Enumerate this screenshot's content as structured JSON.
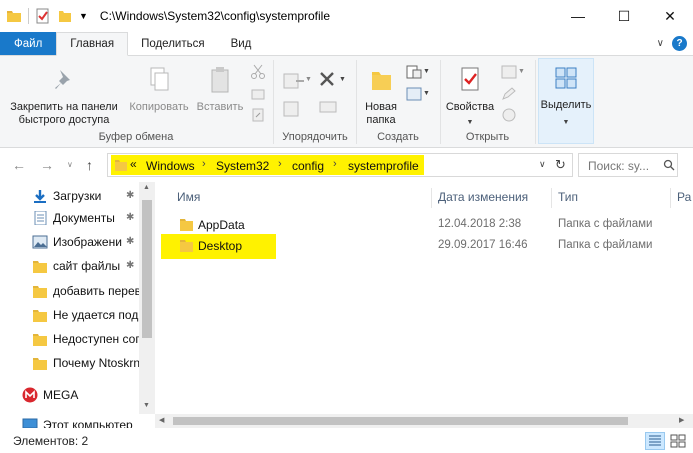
{
  "window": {
    "title": "C:\\Windows\\System32\\config\\systemprofile",
    "minimize": "—",
    "maximize": "☐",
    "close": "✕"
  },
  "tabs": {
    "file": "Файл",
    "home": "Главная",
    "share": "Поделиться",
    "view": "Вид"
  },
  "ribbon": {
    "pin": "Закрепить на панели\nбыстрого доступа",
    "copy": "Копировать",
    "paste": "Вставить",
    "clipboard_group": "Буфер обмена",
    "organize_group": "Упорядочить",
    "new_folder": "Новая\nпапка",
    "create_group": "Создать",
    "properties": "Свойства",
    "open_group": "Открыть",
    "select": "Выделить"
  },
  "address": {
    "prefix": "«",
    "crumbs": [
      "Windows",
      "System32",
      "config",
      "systemprofile"
    ],
    "search_placeholder": "Поиск: sy..."
  },
  "nav_pane": {
    "items": [
      {
        "label": "Загрузки",
        "icon": "download-icon",
        "pinned": true
      },
      {
        "label": "Документы",
        "icon": "documents-icon",
        "pinned": true
      },
      {
        "label": "Изображени",
        "icon": "pictures-icon",
        "pinned": true
      },
      {
        "label": "сайт файлы",
        "icon": "folder-icon",
        "pinned": true
      },
      {
        "label": "добавить перев",
        "icon": "folder-icon",
        "pinned": false
      },
      {
        "label": "Не удается подк",
        "icon": "folder-icon",
        "pinned": false
      },
      {
        "label": "Недоступен сог",
        "icon": "folder-icon",
        "pinned": false
      },
      {
        "label": "Почему Ntoskrn",
        "icon": "folder-icon",
        "pinned": false
      },
      {
        "label": "MEGA",
        "icon": "mega-icon",
        "pinned": false
      },
      {
        "label": "Этот компьютер",
        "icon": "computer-icon",
        "pinned": false
      }
    ]
  },
  "content": {
    "columns": {
      "name": "Имя",
      "date": "Дата изменения",
      "type": "Тип",
      "size": "Ра"
    },
    "rows": [
      {
        "name": "AppData",
        "date": "12.04.2018 2:38",
        "type": "Папка с файлами"
      },
      {
        "name": "Desktop",
        "date": "29.09.2017 16:46",
        "type": "Папка с файлами"
      }
    ]
  },
  "status": {
    "items_count": "Элементов: 2"
  },
  "colors": {
    "accent": "#1979ca",
    "highlight": "#fff200",
    "folder": "#f5c842"
  }
}
